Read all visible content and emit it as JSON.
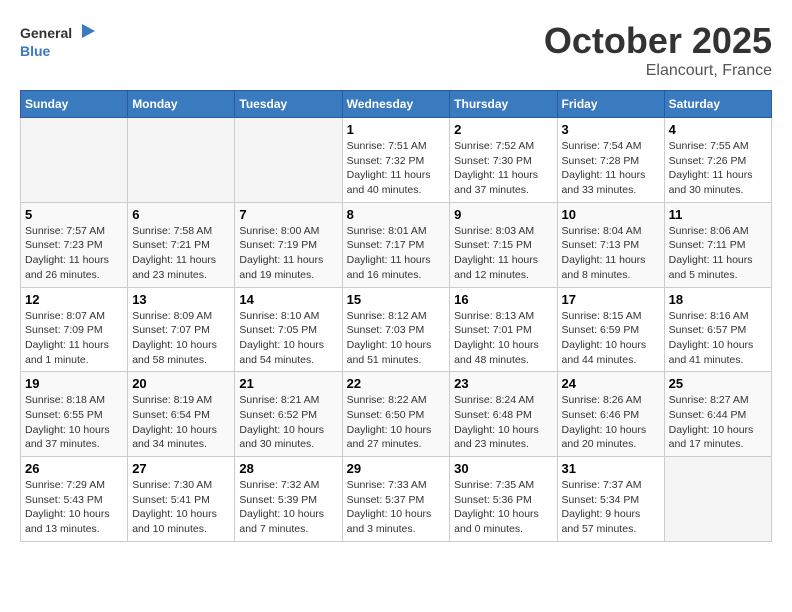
{
  "header": {
    "logo_line1": "General",
    "logo_line2": "Blue",
    "month": "October 2025",
    "location": "Elancourt, France"
  },
  "weekdays": [
    "Sunday",
    "Monday",
    "Tuesday",
    "Wednesday",
    "Thursday",
    "Friday",
    "Saturday"
  ],
  "weeks": [
    [
      {
        "day": "",
        "info": ""
      },
      {
        "day": "",
        "info": ""
      },
      {
        "day": "",
        "info": ""
      },
      {
        "day": "1",
        "info": "Sunrise: 7:51 AM\nSunset: 7:32 PM\nDaylight: 11 hours and 40 minutes."
      },
      {
        "day": "2",
        "info": "Sunrise: 7:52 AM\nSunset: 7:30 PM\nDaylight: 11 hours and 37 minutes."
      },
      {
        "day": "3",
        "info": "Sunrise: 7:54 AM\nSunset: 7:28 PM\nDaylight: 11 hours and 33 minutes."
      },
      {
        "day": "4",
        "info": "Sunrise: 7:55 AM\nSunset: 7:26 PM\nDaylight: 11 hours and 30 minutes."
      }
    ],
    [
      {
        "day": "5",
        "info": "Sunrise: 7:57 AM\nSunset: 7:23 PM\nDaylight: 11 hours and 26 minutes."
      },
      {
        "day": "6",
        "info": "Sunrise: 7:58 AM\nSunset: 7:21 PM\nDaylight: 11 hours and 23 minutes."
      },
      {
        "day": "7",
        "info": "Sunrise: 8:00 AM\nSunset: 7:19 PM\nDaylight: 11 hours and 19 minutes."
      },
      {
        "day": "8",
        "info": "Sunrise: 8:01 AM\nSunset: 7:17 PM\nDaylight: 11 hours and 16 minutes."
      },
      {
        "day": "9",
        "info": "Sunrise: 8:03 AM\nSunset: 7:15 PM\nDaylight: 11 hours and 12 minutes."
      },
      {
        "day": "10",
        "info": "Sunrise: 8:04 AM\nSunset: 7:13 PM\nDaylight: 11 hours and 8 minutes."
      },
      {
        "day": "11",
        "info": "Sunrise: 8:06 AM\nSunset: 7:11 PM\nDaylight: 11 hours and 5 minutes."
      }
    ],
    [
      {
        "day": "12",
        "info": "Sunrise: 8:07 AM\nSunset: 7:09 PM\nDaylight: 11 hours and 1 minute."
      },
      {
        "day": "13",
        "info": "Sunrise: 8:09 AM\nSunset: 7:07 PM\nDaylight: 10 hours and 58 minutes."
      },
      {
        "day": "14",
        "info": "Sunrise: 8:10 AM\nSunset: 7:05 PM\nDaylight: 10 hours and 54 minutes."
      },
      {
        "day": "15",
        "info": "Sunrise: 8:12 AM\nSunset: 7:03 PM\nDaylight: 10 hours and 51 minutes."
      },
      {
        "day": "16",
        "info": "Sunrise: 8:13 AM\nSunset: 7:01 PM\nDaylight: 10 hours and 48 minutes."
      },
      {
        "day": "17",
        "info": "Sunrise: 8:15 AM\nSunset: 6:59 PM\nDaylight: 10 hours and 44 minutes."
      },
      {
        "day": "18",
        "info": "Sunrise: 8:16 AM\nSunset: 6:57 PM\nDaylight: 10 hours and 41 minutes."
      }
    ],
    [
      {
        "day": "19",
        "info": "Sunrise: 8:18 AM\nSunset: 6:55 PM\nDaylight: 10 hours and 37 minutes."
      },
      {
        "day": "20",
        "info": "Sunrise: 8:19 AM\nSunset: 6:54 PM\nDaylight: 10 hours and 34 minutes."
      },
      {
        "day": "21",
        "info": "Sunrise: 8:21 AM\nSunset: 6:52 PM\nDaylight: 10 hours and 30 minutes."
      },
      {
        "day": "22",
        "info": "Sunrise: 8:22 AM\nSunset: 6:50 PM\nDaylight: 10 hours and 27 minutes."
      },
      {
        "day": "23",
        "info": "Sunrise: 8:24 AM\nSunset: 6:48 PM\nDaylight: 10 hours and 23 minutes."
      },
      {
        "day": "24",
        "info": "Sunrise: 8:26 AM\nSunset: 6:46 PM\nDaylight: 10 hours and 20 minutes."
      },
      {
        "day": "25",
        "info": "Sunrise: 8:27 AM\nSunset: 6:44 PM\nDaylight: 10 hours and 17 minutes."
      }
    ],
    [
      {
        "day": "26",
        "info": "Sunrise: 7:29 AM\nSunset: 5:43 PM\nDaylight: 10 hours and 13 minutes."
      },
      {
        "day": "27",
        "info": "Sunrise: 7:30 AM\nSunset: 5:41 PM\nDaylight: 10 hours and 10 minutes."
      },
      {
        "day": "28",
        "info": "Sunrise: 7:32 AM\nSunset: 5:39 PM\nDaylight: 10 hours and 7 minutes."
      },
      {
        "day": "29",
        "info": "Sunrise: 7:33 AM\nSunset: 5:37 PM\nDaylight: 10 hours and 3 minutes."
      },
      {
        "day": "30",
        "info": "Sunrise: 7:35 AM\nSunset: 5:36 PM\nDaylight: 10 hours and 0 minutes."
      },
      {
        "day": "31",
        "info": "Sunrise: 7:37 AM\nSunset: 5:34 PM\nDaylight: 9 hours and 57 minutes."
      },
      {
        "day": "",
        "info": ""
      }
    ]
  ]
}
